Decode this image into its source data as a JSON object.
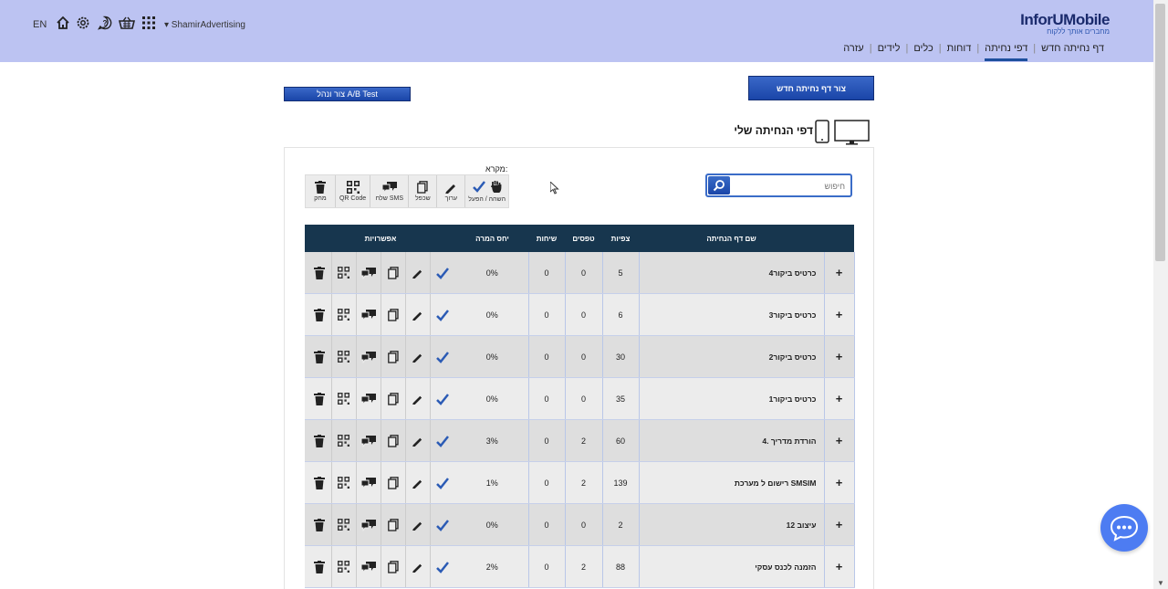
{
  "header": {
    "lang": "EN",
    "user": "▾ ShamirAdvertising",
    "logo_name": "InforUMobile",
    "logo_tagline": "מחברים אותך ללקוח",
    "icons": [
      "home-icon",
      "gear-icon",
      "help-icon",
      "basket-icon",
      "apps-grid-icon"
    ],
    "nav": [
      {
        "label": "דף נחיתה חדש",
        "active": false
      },
      {
        "label": "דפי נחיתה",
        "active": true
      },
      {
        "label": "דוחות",
        "active": false
      },
      {
        "label": "כלים",
        "active": false
      },
      {
        "label": "לידים",
        "active": false
      },
      {
        "label": "עזרה",
        "active": false
      }
    ]
  },
  "buttons": {
    "new_page": "צור דף נחיתה חדש",
    "ab_test": "צור ונהל A/B Test"
  },
  "page_title": "דפי הנחיתה שלי",
  "search": {
    "placeholder": "חיפוש"
  },
  "legend": {
    "title": "מקרא:",
    "items": [
      "השהה / הפעל",
      "ערוך",
      "שכפל",
      "שלח SMS",
      "QR Code",
      "מחק"
    ]
  },
  "table": {
    "headers": {
      "name": "שם דף הנחיתה",
      "views": "צפיות",
      "forms": "טפסים",
      "calls": "שיחות",
      "conversion": "יחס המרה",
      "options": "אפשרויות"
    },
    "rows": [
      {
        "name": "כרטיס ביקור4",
        "views": "5",
        "forms": "0",
        "calls": "0",
        "conversion": "0%"
      },
      {
        "name": "כרטיס ביקור3",
        "views": "6",
        "forms": "0",
        "calls": "0",
        "conversion": "0%"
      },
      {
        "name": "כרטיס ביקור2",
        "views": "30",
        "forms": "0",
        "calls": "0",
        "conversion": "0%"
      },
      {
        "name": "כרטיס ביקור1",
        "views": "35",
        "forms": "0",
        "calls": "0",
        "conversion": "0%"
      },
      {
        "name": "4. הורדת מדריך",
        "views": "60",
        "forms": "2",
        "calls": "0",
        "conversion": "3%"
      },
      {
        "name": "רישום ל מערכת SMSIM",
        "views": "139",
        "forms": "2",
        "calls": "0",
        "conversion": "1%"
      },
      {
        "name": "עיצוב 12",
        "views": "2",
        "forms": "0",
        "calls": "0",
        "conversion": "0%"
      },
      {
        "name": "הזמנה לכנס עסקי",
        "views": "88",
        "forms": "2",
        "calls": "0",
        "conversion": "2%"
      }
    ]
  },
  "colors": {
    "header_bg": "#bcc3f2",
    "table_head": "#17364e",
    "button": "#2450b4",
    "chat": "#4d7cf2"
  }
}
